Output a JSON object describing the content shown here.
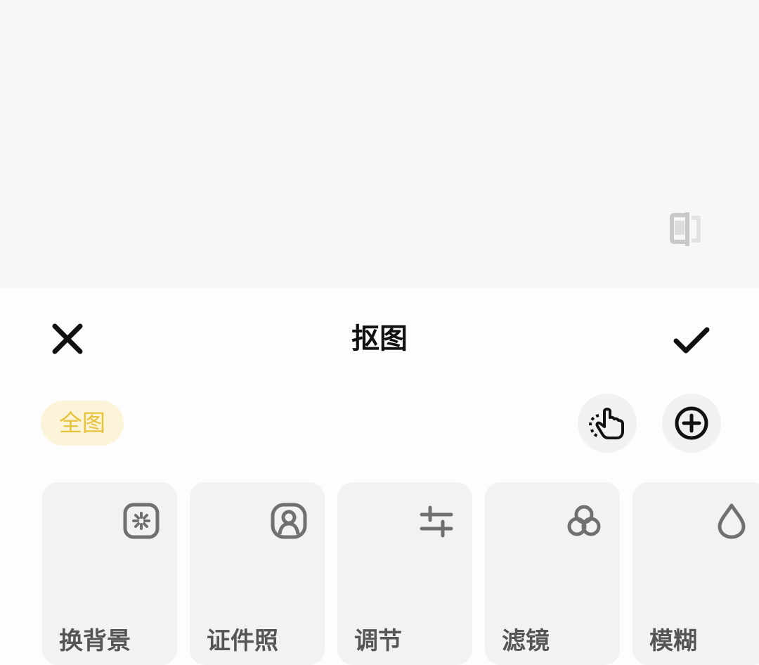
{
  "header": {
    "title": "抠图"
  },
  "segment": {
    "active_chip_label": "全图"
  },
  "colors": {
    "accent": "#e7c33c",
    "chip_bg": "#fbf4d8",
    "card_bg": "#f2f2f2",
    "icon_gray": "#707070"
  },
  "cards": [
    {
      "label": "换背景",
      "icon": "aperture-icon"
    },
    {
      "label": "证件照",
      "icon": "id-photo-icon"
    },
    {
      "label": "调节",
      "icon": "sliders-icon"
    },
    {
      "label": "滤镜",
      "icon": "filter-circles-icon"
    },
    {
      "label": "模糊",
      "icon": "droplet-icon"
    }
  ]
}
